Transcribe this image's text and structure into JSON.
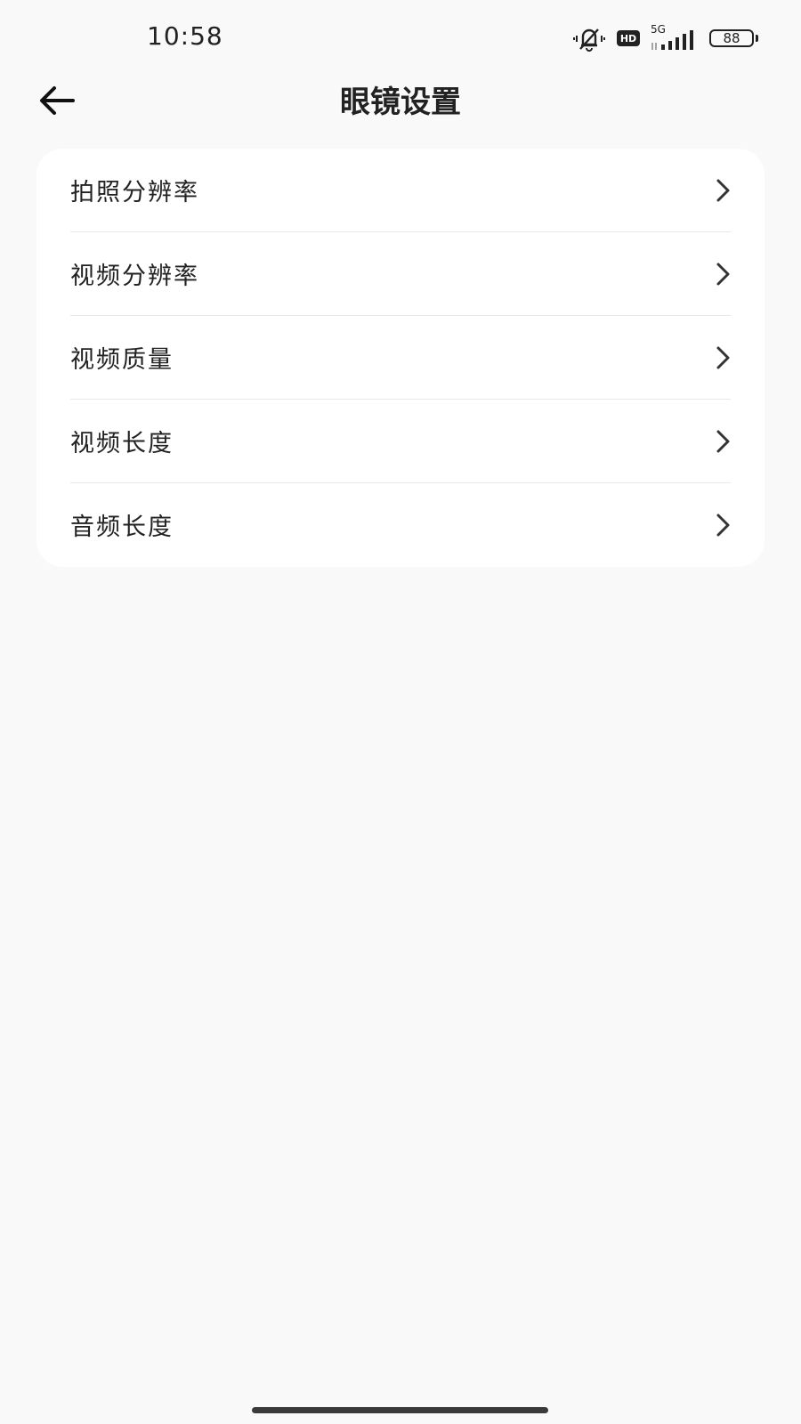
{
  "status_bar": {
    "time": "10:58",
    "hd_label": "HD",
    "network_label": "5G",
    "battery_level": "88",
    "icons": [
      "vibrate-mute-icon",
      "hd-icon",
      "signal-5g-icon",
      "battery-icon"
    ]
  },
  "header": {
    "title": "眼镜设置",
    "back_icon": "arrow-left-icon"
  },
  "settings": {
    "items": [
      {
        "label": "拍照分辨率"
      },
      {
        "label": "视频分辨率"
      },
      {
        "label": "视频质量"
      },
      {
        "label": "视频长度"
      },
      {
        "label": "音频长度"
      }
    ],
    "chevron_icon": "chevron-right-icon"
  },
  "colors": {
    "background": "#f9f9f9",
    "card": "#ffffff",
    "text": "#222222",
    "divider": "#e8e8e8"
  }
}
